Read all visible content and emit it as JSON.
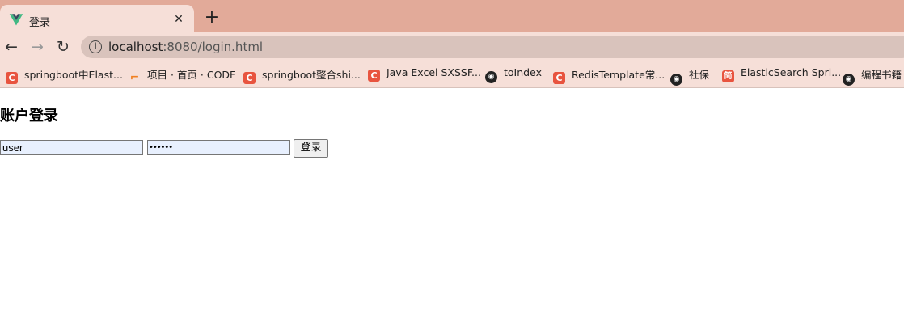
{
  "browser": {
    "tab": {
      "title": "登录",
      "close_glyph": "✕",
      "favicon": "vue-logo-icon"
    },
    "new_tab_glyph": "+",
    "nav": {
      "back_glyph": "←",
      "forward_glyph": "→",
      "reload_glyph": "↻"
    },
    "omnibox": {
      "host": "localhost",
      "path": ":8080/login.html",
      "info_glyph": "i"
    },
    "bookmarks": [
      {
        "label": "springboot中Elast...",
        "icon": "csdn-icon",
        "glyph": "C"
      },
      {
        "label": "项目 · 首页 · CODE",
        "icon": "code-icon",
        "glyph": "⌐"
      },
      {
        "label": "springboot整合shi...",
        "icon": "csdn-icon",
        "glyph": "C"
      },
      {
        "label": "Java Excel SXSSF...",
        "icon": "csdn-icon",
        "glyph": "C"
      },
      {
        "label": "toIndex",
        "icon": "globe-icon",
        "glyph": "◉"
      },
      {
        "label": "RedisTemplate常...",
        "icon": "csdn-icon",
        "glyph": "C"
      },
      {
        "label": "社保",
        "icon": "globe-icon",
        "glyph": "◉"
      },
      {
        "label": "ElasticSearch Spri...",
        "icon": "jianshu-icon",
        "glyph": "简"
      },
      {
        "label": "编程书籍",
        "icon": "github-icon",
        "glyph": "◉"
      }
    ]
  },
  "page": {
    "heading": "账户登录",
    "username": {
      "value": "user"
    },
    "password": {
      "value": "••••••"
    },
    "submit_label": "登录"
  },
  "colors": {
    "tabstrip": "#e2aa99",
    "toolbar": "#f6dfd8",
    "omnibox": "#d9c3bc",
    "autofill": "#e8f0fe"
  }
}
